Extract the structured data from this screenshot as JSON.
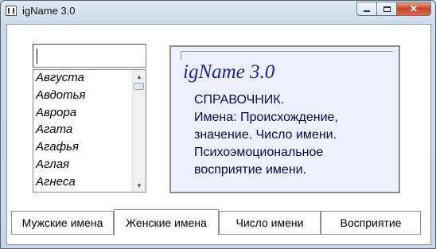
{
  "window": {
    "title": "igName 3.0",
    "close_glyph": "✕",
    "icons": [
      "app-icon",
      "minimize-icon",
      "maximize-icon",
      "close-icon"
    ]
  },
  "search": {
    "value": ""
  },
  "names_list": {
    "items": [
      "Августа",
      "Авдотья",
      "Аврора",
      "Агата",
      "Агафья",
      "Аглая",
      "Агнеса"
    ],
    "scroll_up_glyph": "▲",
    "scroll_down_glyph": "▼"
  },
  "info": {
    "title": "igName 3.0",
    "lines": [
      "СПРАВОЧНИК.",
      "Имена: Происхождение,",
      "значение. Число имени.",
      "Психоэмоциональное",
      "восприятие имени."
    ]
  },
  "tabs": [
    {
      "label": "Мужские имена",
      "active": false
    },
    {
      "label": "Женские имена",
      "active": true
    },
    {
      "label": "Число имени",
      "active": false
    },
    {
      "label": "Восприятие",
      "active": false
    }
  ],
  "colors": {
    "info_background": "#eef0ff",
    "info_title": "#1a2a8a",
    "info_text": "#08084a",
    "close_button": "#c9452a"
  }
}
